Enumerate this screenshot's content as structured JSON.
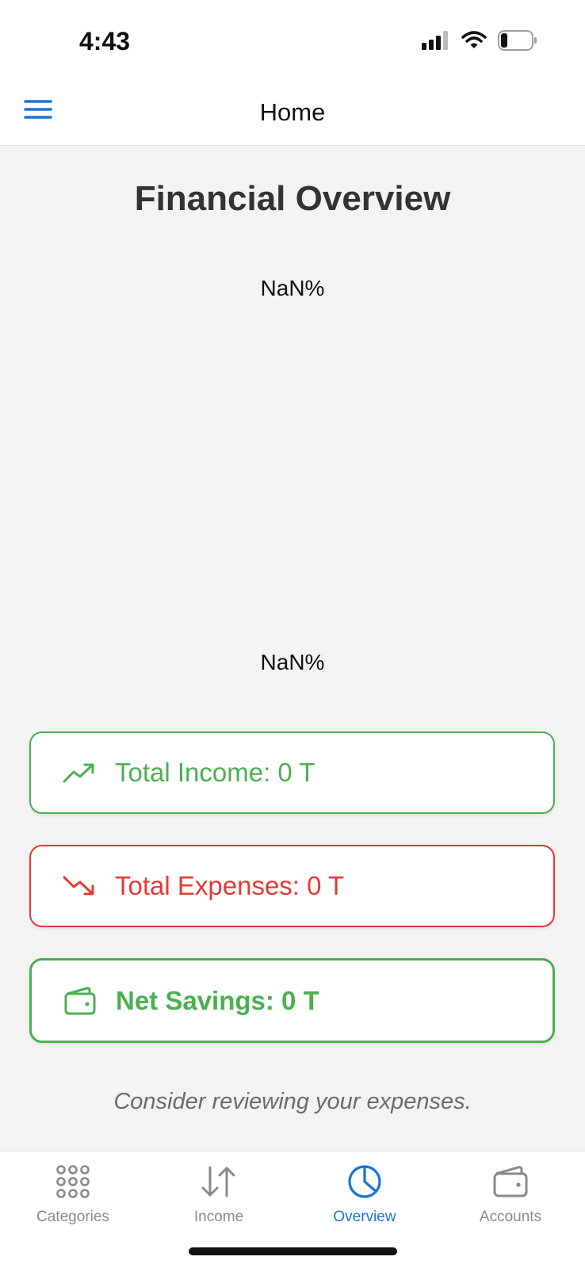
{
  "status_bar": {
    "time": "4:43",
    "icons": [
      "cellular-signal-icon",
      "wifi-icon",
      "battery-icon"
    ]
  },
  "header": {
    "title": "Home",
    "menu_icon": "hamburger-menu-icon"
  },
  "main": {
    "title": "Financial Overview",
    "chart_top_label": "NaN%",
    "chart_bottom_label": "NaN%",
    "cards": {
      "income": {
        "label": "Total Income: 0 T",
        "icon": "trending-up-icon",
        "color": "#4caf50"
      },
      "expenses": {
        "label": "Total Expenses: 0 T",
        "icon": "trending-down-icon",
        "color": "#e53935"
      },
      "savings": {
        "label": "Net Savings: 0 T",
        "icon": "wallet-icon",
        "color": "#4caf50"
      }
    },
    "hint": "Consider reviewing your expenses."
  },
  "tabs": [
    {
      "label": "Categories",
      "icon": "grid-dots-icon",
      "active": false
    },
    {
      "label": "Income",
      "icon": "arrows-up-down-icon",
      "active": false
    },
    {
      "label": "Overview",
      "icon": "pie-chart-icon",
      "active": true
    },
    {
      "label": "Accounts",
      "icon": "wallet-icon",
      "active": false
    }
  ],
  "colors": {
    "accent": "#1a73d9",
    "inactive": "#8a8a8a",
    "income": "#4caf50",
    "expense": "#e53935"
  }
}
